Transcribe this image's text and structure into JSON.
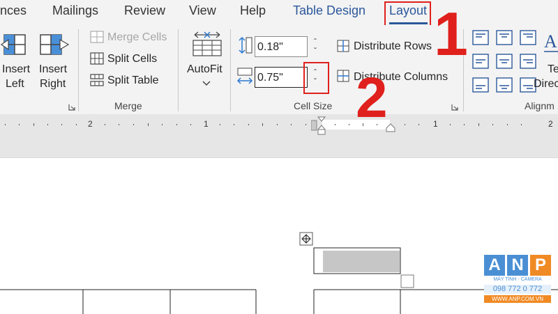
{
  "tabs": [
    {
      "label": "nces"
    },
    {
      "label": "Mailings"
    },
    {
      "label": "Review"
    },
    {
      "label": "View"
    },
    {
      "label": "Help"
    },
    {
      "label": "Table Design"
    },
    {
      "label": "Layout"
    }
  ],
  "ribbon": {
    "insert_left_1": "Insert",
    "insert_left_2": "Left",
    "insert_right_1": "Insert",
    "insert_right_2": "Right",
    "merge_cells": "Merge Cells",
    "split_cells": "Split Cells",
    "split_table": "Split Table",
    "merge_group": "Merge",
    "autofit": "AutoFit",
    "row_height": "0.18\"",
    "col_width": "0.75\"",
    "distribute_rows": "Distribute Rows",
    "distribute_columns": "Distribute Columns",
    "cell_size_group": "Cell Size",
    "text_dir_1": "Te",
    "text_dir_2": "Direc",
    "alignment_group": "Alignm"
  },
  "ruler": {
    "n2a": "2",
    "n1a": "1",
    "n1b": "1",
    "n2b": "2"
  },
  "annotations": {
    "step1": "1",
    "step2": "2"
  },
  "watermark": {
    "letters": [
      "A",
      "N",
      "P"
    ],
    "line1": "MÁY TÍNH - CAMERA",
    "phone": "098 772 0 772",
    "site": "WWW.ANP.COM.VN"
  },
  "colors": {
    "accent": "#2b579a",
    "highlight": "#e0201c",
    "anp_blue": "#4a8fd4",
    "anp_orange": "#f08a24"
  }
}
